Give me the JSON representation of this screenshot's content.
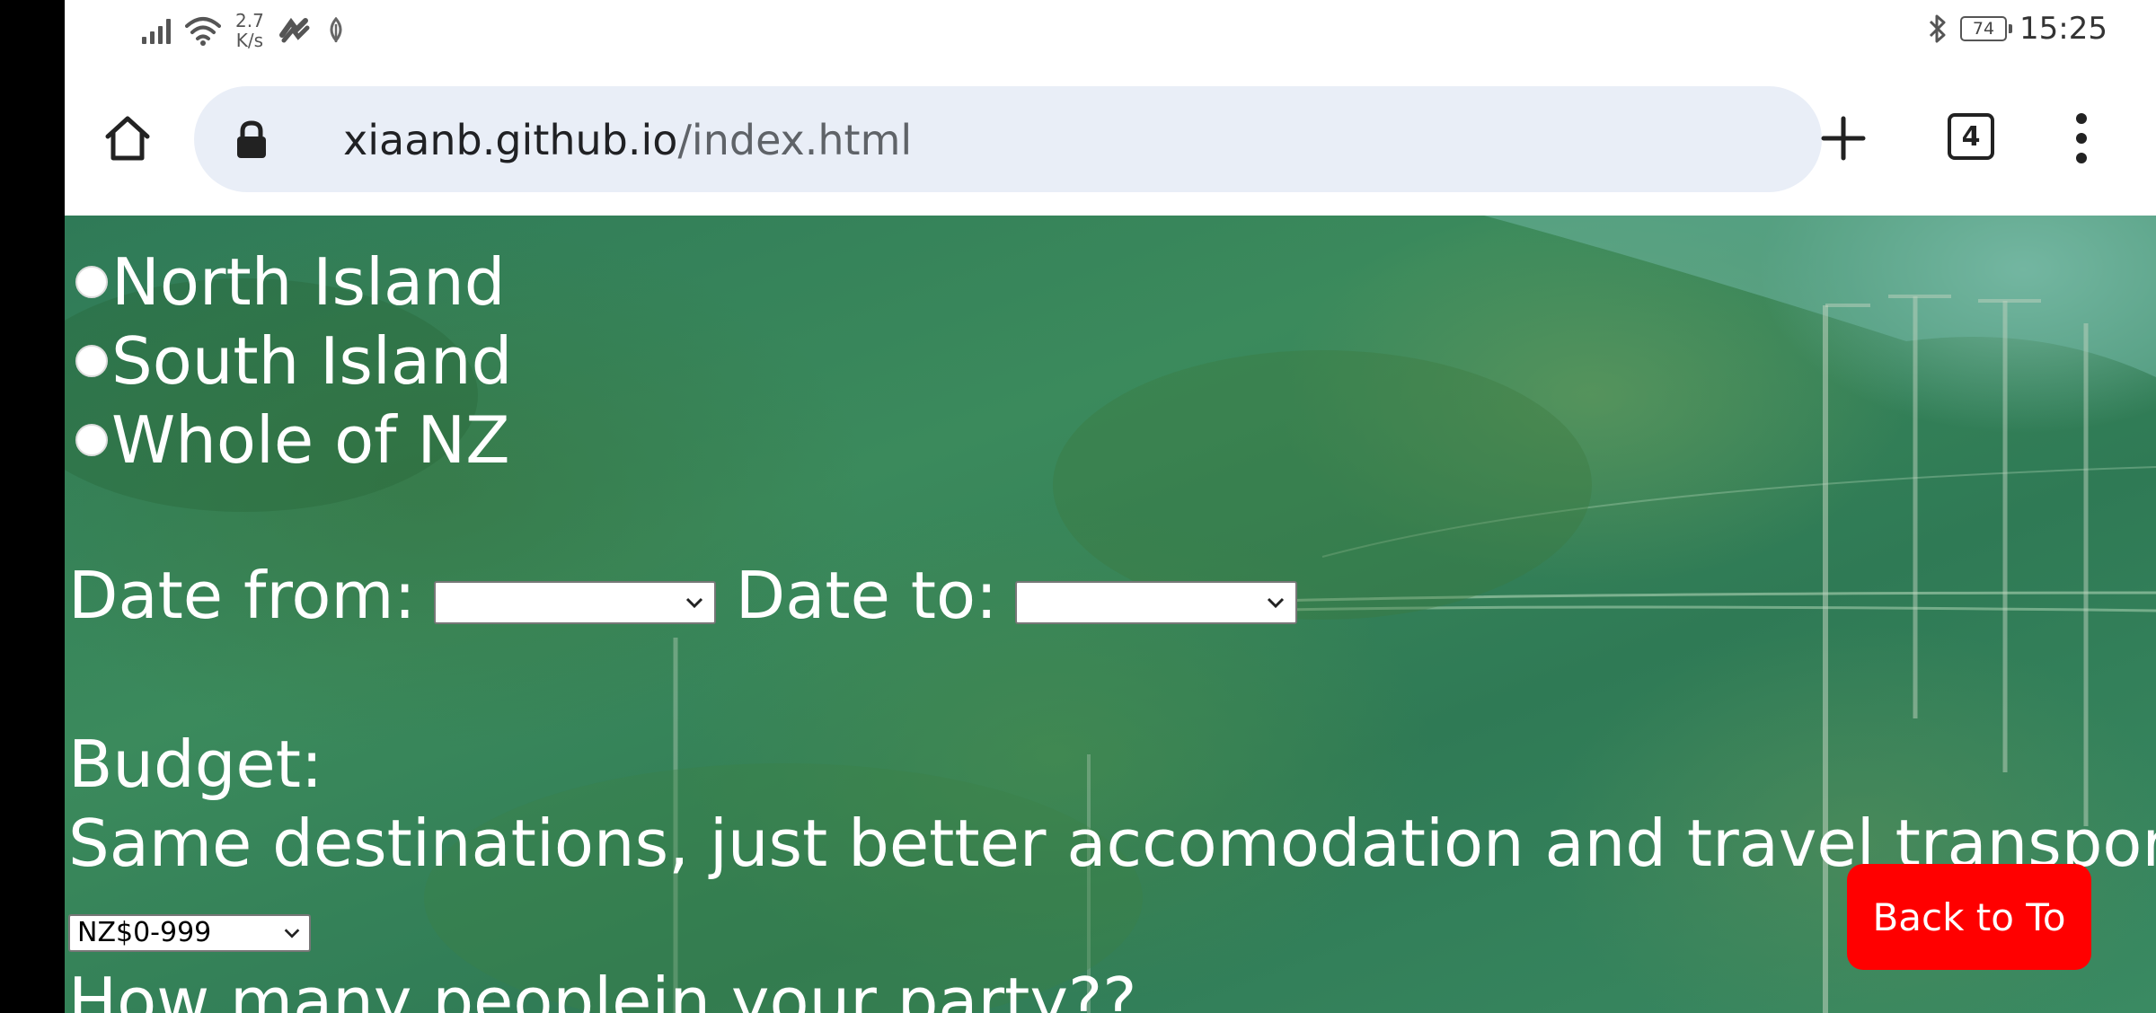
{
  "status_bar": {
    "net_speed_value": "2.7",
    "net_speed_unit": "K/s",
    "battery": "74",
    "time": "15:25"
  },
  "browser": {
    "url_host": "xiaanb.github.io",
    "url_path": "/index.html",
    "tab_count": "4"
  },
  "form": {
    "regions": [
      "North Island",
      "South Island",
      "Whole of NZ"
    ],
    "date_from_label": "Date from:",
    "date_to_label": "Date to:",
    "date_from_value": "",
    "date_to_value": "",
    "budget_label": "Budget:",
    "budget_note": "Same destinations, just better accomodation and travel transport",
    "budget_selected": "NZ$0-999",
    "party_label": "How many peoplein your party??"
  },
  "back_to_top_label": "Back to To"
}
